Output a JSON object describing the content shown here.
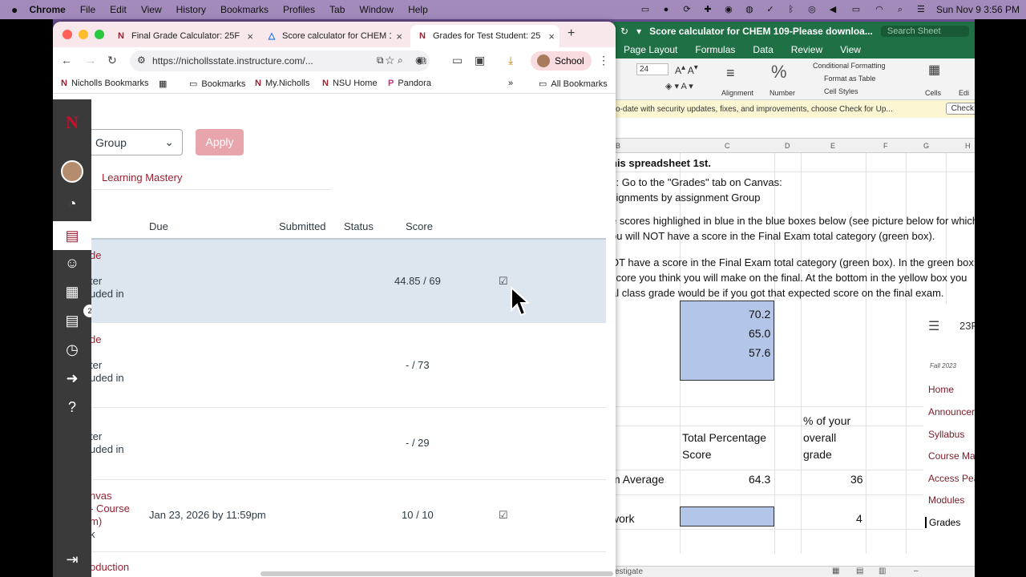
{
  "menubar": {
    "apple": "",
    "app": "Chrome",
    "items": [
      "File",
      "Edit",
      "View",
      "History",
      "Bookmarks",
      "Profiles",
      "Tab",
      "Window",
      "Help"
    ],
    "datetime": "Sun Nov 9  3:56 PM"
  },
  "chrome": {
    "tabs": [
      {
        "title": "Final Grade Calculator: 25F C",
        "favicon": "N"
      },
      {
        "title": "Score calculator for CHEM 10",
        "favicon": "△"
      },
      {
        "title": "Grades for Test Student: 25F",
        "favicon": "N"
      }
    ],
    "url": "https://nichollsstate.instructure.com/...",
    "profile": "School",
    "bookmarks": [
      "Nicholls Bookmarks",
      "Bookmarks",
      "My.Nicholls",
      "NSU Home",
      "Pandora"
    ],
    "all_bookmarks": "All Bookmarks"
  },
  "canvas": {
    "group_select": "Group",
    "apply": "Apply",
    "learning_mastery": "Learning Mastery",
    "headers": {
      "due": "Due",
      "submitted": "Submitted",
      "status": "Status",
      "score": "Score"
    },
    "rows": [
      {
        "name": "de",
        "sub1": "ter",
        "sub2": "uded in",
        "due": "",
        "score": "44.85 / 69"
      },
      {
        "name": "de",
        "sub1": "ter",
        "sub2": "uded in",
        "due": "",
        "score": "- / 73"
      },
      {
        "name": "",
        "sub1": "ter",
        "sub2": "uded in",
        "due": "",
        "score": "- / 29"
      },
      {
        "name": "nvas",
        "name2": "- Course",
        "name3": "m)",
        "name4": "k",
        "due": "Jan 23, 2026 by 11:59pm",
        "score": "10 / 10"
      },
      {
        "name": "oduction",
        "due": "",
        "score": ""
      }
    ],
    "inbox_badge": "2"
  },
  "excel": {
    "title": "Score calculator for CHEM 109-Please downloa...",
    "search": "Search Sheet",
    "tabs": [
      "Page Layout",
      "Formulas",
      "Data",
      "Review",
      "View"
    ],
    "font_size": "24",
    "ribbon": {
      "alignment": "Alignment",
      "number": "Number",
      "cond_format": "Conditional Formatting",
      "format_table": "Format as Table",
      "cell_styles": "Cell Styles",
      "cells": "Cells",
      "edit": "Edi"
    },
    "message": "o-date with security updates, fixes, and improvements, choose Check for Up...",
    "message_btn": "Check",
    "columns": [
      "B",
      "C",
      "D",
      "E",
      "F",
      "G",
      "H"
    ],
    "lines": [
      "his spreadsheet 1st.",
      "s: Go to the \"Grades\" tab on Canvas:",
      "signments by assignment Group",
      "e scores highlighed in blue in the blue boxes below (see picture below for which",
      "ou will NOT have a score in the Final Exam total category (green box).",
      "OT have a score in the Final Exam total category (green box).  In the green box,",
      "score you think you will make on the final.  At the bottom in the yellow box you",
      "al class grade would be if you got that expected score on the final exam."
    ],
    "blue_values": [
      "70.2",
      "65.0",
      "57.6"
    ],
    "col_c_header": "Total Percentage Score",
    "col_c_header_l1": "Total Percentage",
    "col_c_header_l2": "Score",
    "col_d_header_l1": "% of your",
    "col_d_header_l2": "overall",
    "col_d_header_l3": "grade",
    "exam_label": "m Average",
    "exam_score": "64.3",
    "exam_weight": "36",
    "hw_label": "work",
    "hw_weight": "4",
    "status": "vestigate",
    "canvas_nav": {
      "course": "23F",
      "term": "Fall 2023",
      "items": [
        "Home",
        "Announcer",
        "Syllabus",
        "Course Ma",
        "Access Pea",
        "Modules",
        "Grades"
      ]
    }
  }
}
